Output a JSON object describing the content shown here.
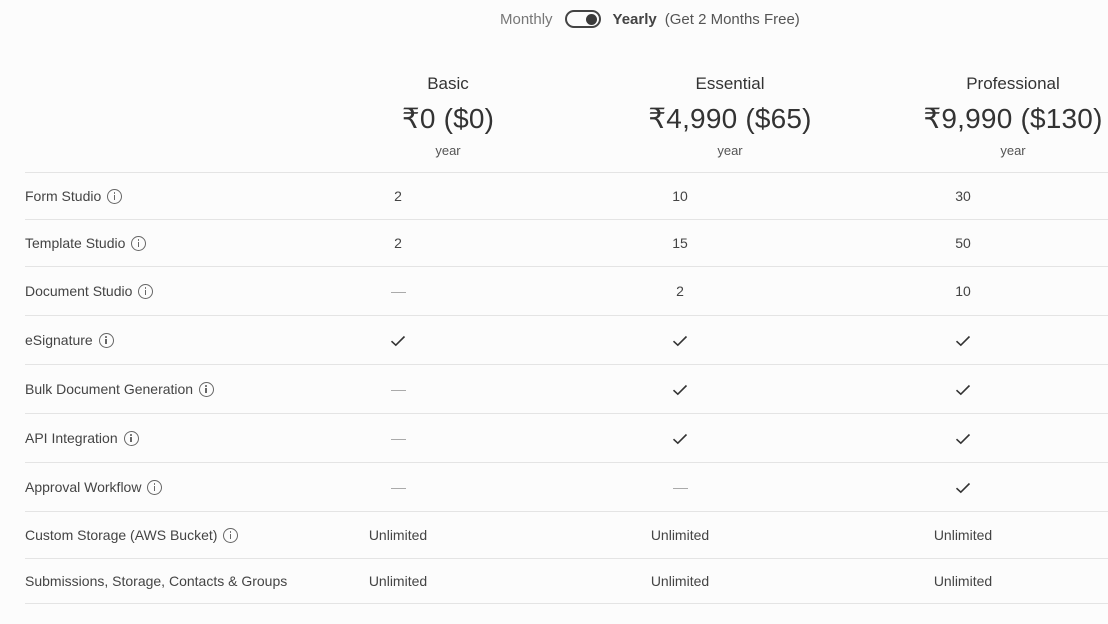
{
  "billing_toggle": {
    "monthly_label": "Monthly",
    "yearly_label": "Yearly",
    "promo_label": "(Get 2 Months Free)",
    "selected": "Yearly"
  },
  "plans": [
    {
      "name": "Basic",
      "price": "₹0 ($0)",
      "period": "year"
    },
    {
      "name": "Essential",
      "price": "₹4,990 ($65)",
      "period": "year"
    },
    {
      "name": "Professional",
      "price": "₹9,990 ($130)",
      "period": "year"
    }
  ],
  "features": [
    {
      "label": "Form Studio",
      "info_icon": "info-icon",
      "values": [
        "2",
        "10",
        "30"
      ]
    },
    {
      "label": "Template Studio",
      "info_icon": "info-icon",
      "values": [
        "2",
        "15",
        "50"
      ]
    },
    {
      "label": "Document Studio",
      "info_icon": "info-icon",
      "values": [
        "dash",
        "2",
        "10"
      ]
    },
    {
      "label": "eSignature",
      "info_icon": "info-icon",
      "values": [
        "check",
        "check",
        "check"
      ]
    },
    {
      "label": "Bulk Document Generation",
      "info_icon": "info-icon",
      "values": [
        "dash",
        "check",
        "check"
      ]
    },
    {
      "label": "API Integration",
      "info_icon": "info-icon",
      "values": [
        "dash",
        "check",
        "check"
      ]
    },
    {
      "label": "Approval Workflow",
      "info_icon": "info-icon",
      "values": [
        "dash",
        "dash",
        "check"
      ]
    },
    {
      "label": "Custom Storage (AWS Bucket)",
      "info_icon": "info-icon",
      "values": [
        "Unlimited",
        "Unlimited",
        "Unlimited"
      ]
    },
    {
      "label": "Submissions, Storage, Contacts & Groups",
      "info_icon": null,
      "values": [
        "Unlimited",
        "Unlimited",
        "Unlimited"
      ]
    }
  ]
}
